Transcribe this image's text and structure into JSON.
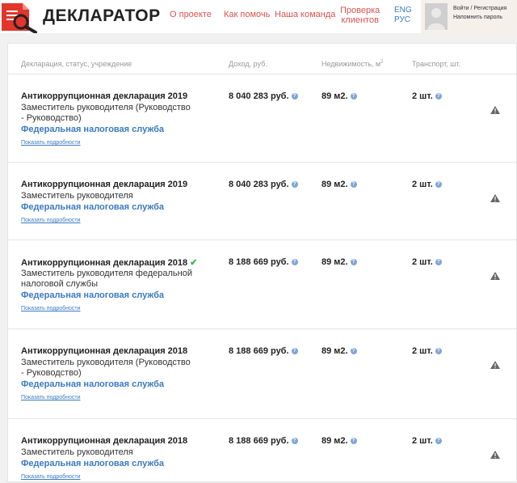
{
  "header": {
    "brand": "ДЕКЛАРАТОР",
    "nav": {
      "about": "О проекте",
      "help": "Как помочь",
      "team": "Наша команда",
      "check_line1": "Проверка",
      "check_line2": "клиентов",
      "lang_en": "ENG",
      "lang_ru": "РУС"
    },
    "user": {
      "login_register": "Войти / Регистрация",
      "remind_password": "Напомнить пароль"
    }
  },
  "columns": {
    "declaration": "Декларация, статус, учреждение",
    "income": "Доход, руб.",
    "realty": "Недвижимость, м",
    "realty_sup": "2",
    "transport": "Транспорт, шт."
  },
  "rows": [
    {
      "title": "Антикоррупционная декларация 2019",
      "verified": false,
      "position": "Заместитель руководителя (Руководство - Руководство)",
      "org": "Федеральная налоговая служба",
      "details": "Показать подробности",
      "income": "8 040 283 руб.",
      "realty": "89 м2.",
      "transport": "2 шт."
    },
    {
      "title": "Антикоррупционная декларация 2019",
      "verified": false,
      "position": "Заместитель руководителя",
      "org": "Федеральная налоговая служба",
      "details": "Показать подробности",
      "income": "8 040 283 руб.",
      "realty": "89 м2.",
      "transport": "2 шт."
    },
    {
      "title": "Антикоррупционная декларация 2018",
      "verified": true,
      "position": "Заместитель руководителя федеральной налоговой службы",
      "org": "Федеральная налоговая служба",
      "details": "Показать подробности",
      "income": "8 188 669 руб.",
      "realty": "89 м2.",
      "transport": "2 шт."
    },
    {
      "title": "Антикоррупционная декларация 2018",
      "verified": false,
      "position": "Заместитель руководителя (Руководство - Руководство)",
      "org": "Федеральная налоговая служба",
      "details": "Показать подробности",
      "income": "8 188 669 руб.",
      "realty": "89 м2.",
      "transport": "2 шт."
    },
    {
      "title": "Антикоррупционная декларация 2018",
      "verified": false,
      "position": "Заместитель руководителя",
      "org": "Федеральная налоговая служба",
      "details": "Показать подробности",
      "income": "8 188 669 руб.",
      "realty": "89 м2.",
      "transport": "2 шт."
    }
  ],
  "colors": {
    "accent_red": "#d9534f",
    "link_blue": "#3a7abf",
    "check_green": "#3bb34a"
  },
  "icons": {
    "logo": "document-magnifier-icon",
    "help": "question-circle-icon",
    "warning": "warning-triangle-icon",
    "verified": "check-icon",
    "avatar": "user-silhouette-icon"
  }
}
